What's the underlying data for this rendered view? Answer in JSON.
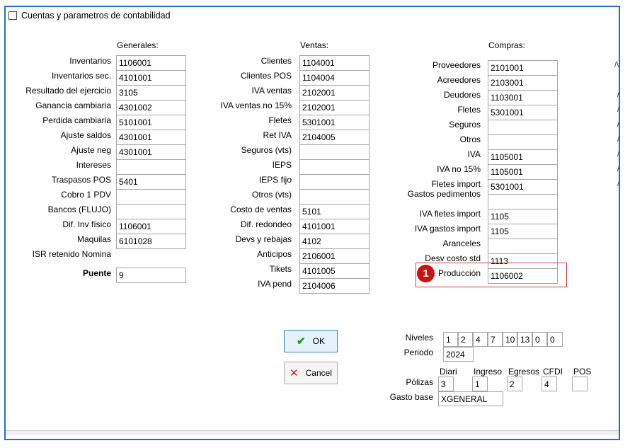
{
  "title": "Cuentas y parametros de contabilidad",
  "headers": {
    "generales": "Generales:",
    "ventas": "Ventas:",
    "compras": "Compras:"
  },
  "generales": [
    {
      "label": "Inventarios",
      "value": "1106001"
    },
    {
      "label": "Inventarios sec.",
      "value": "4101001"
    },
    {
      "label": "Resultado del ejercicio",
      "value": "3105"
    },
    {
      "label": "Ganancia cambiaria",
      "value": "4301002"
    },
    {
      "label": "Perdida cambiaria",
      "value": "5101001"
    },
    {
      "label": "Ajuste saldos",
      "value": "4301001"
    },
    {
      "label": "Ajuste neg",
      "value": "4301001"
    },
    {
      "label": "Intereses",
      "value": ""
    },
    {
      "label": "Traspasos POS",
      "value": "5401"
    },
    {
      "label": "Cobro 1 PDV",
      "value": ""
    },
    {
      "label": "Bancos (FLUJO)",
      "value": ""
    },
    {
      "label": "Dif. Inv físico",
      "value": "1106001"
    },
    {
      "label": "Maquilas",
      "value": "6101028"
    },
    {
      "label": "ISR retenido Nomina",
      "value": ""
    }
  ],
  "puente": {
    "label": "Puente",
    "value": "9"
  },
  "ventas": [
    {
      "label": "Clientes",
      "value": "1104001"
    },
    {
      "label": "Clientes POS",
      "value": "1104004"
    },
    {
      "label": "IVA ventas",
      "value": "2102001"
    },
    {
      "label": "IVA ventas no 15%",
      "value": "2102001"
    },
    {
      "label": "Fletes",
      "value": "5301001"
    },
    {
      "label": "Ret IVA",
      "value": "2104005"
    },
    {
      "label": "Seguros (vts)",
      "value": ""
    },
    {
      "label": "IEPS",
      "value": ""
    },
    {
      "label": "IEPS fijo",
      "value": ""
    },
    {
      "label": "Otros (vts)",
      "value": ""
    },
    {
      "label": "Costo de ventas",
      "value": "5101"
    },
    {
      "label": "Dif. redondeo",
      "value": "4101001"
    },
    {
      "label": "Devs y rebajas",
      "value": "4102"
    },
    {
      "label": "Anticipos",
      "value": "2106001"
    },
    {
      "label": "Tikets",
      "value": "4101005"
    },
    {
      "label": "IVA pend",
      "value": "2104006"
    }
  ],
  "compras": [
    {
      "label": "Proveedores",
      "value": "2101001"
    },
    {
      "label": "Acreedores",
      "value": "2103001"
    },
    {
      "label": "Deudores",
      "value": "1103001"
    },
    {
      "label": "Fletes",
      "value": "5301001"
    },
    {
      "label": "Seguros",
      "value": ""
    },
    {
      "label": "Otros",
      "value": ""
    },
    {
      "label": "IVA",
      "value": "1105001"
    },
    {
      "label": "IVA  no 15%",
      "value": "1105001"
    },
    {
      "label": "Fletes import",
      "value": "5301001"
    },
    {
      "label": "Gastos pedimentos",
      "value": ""
    },
    {
      "label": "IVA fletes import",
      "value": "1105"
    },
    {
      "label": "IVA gastos import",
      "value": "1105"
    },
    {
      "label": "Aranceles",
      "value": ""
    },
    {
      "label": "Desv costo std",
      "value": "1113"
    },
    {
      "label": "Producción",
      "value": "1106002"
    }
  ],
  "cut_marks": [
    "/\\",
    "/",
    "/",
    "/",
    "/",
    "/",
    "/",
    "/",
    "/"
  ],
  "buttons": {
    "ok": "OK",
    "cancel": "Cancel"
  },
  "niveles": {
    "label": "Niveles",
    "values": [
      "1",
      "2",
      "4",
      "7",
      "10",
      "13",
      "0",
      "0"
    ]
  },
  "periodo": {
    "label": "Periodo",
    "value": "2024"
  },
  "polizas": {
    "label": "Pólizas",
    "columns": [
      {
        "header": "Diari",
        "value": "3"
      },
      {
        "header": "Ingreso",
        "value": "1"
      },
      {
        "header": "Egresos",
        "value": "2"
      },
      {
        "header": "CFDI",
        "value": "4"
      },
      {
        "header": "POS",
        "value": ""
      }
    ]
  },
  "gasto_base": {
    "label": "Gasto base",
    "value": "XGENERAL"
  },
  "annotation": {
    "number": "1",
    "color": "#cc1111"
  }
}
